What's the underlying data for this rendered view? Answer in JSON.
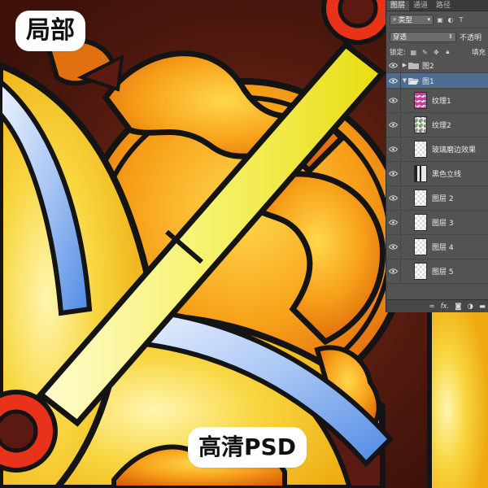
{
  "overlay": {
    "label_local": "局部",
    "label_hd": "高清PSD"
  },
  "layers_panel": {
    "tabs": [
      {
        "label": "图层",
        "active": true
      },
      {
        "label": "通道",
        "active": false
      },
      {
        "label": "路径",
        "active": false
      }
    ],
    "filter": {
      "value": "类型",
      "icons": [
        "image-filter-icon",
        "adjustment-filter-icon",
        "type-filter-icon"
      ]
    },
    "blend_mode": "穿透",
    "opacity_label": "不透明",
    "lock_label": "锁定:",
    "fill_label": "填充",
    "layers": [
      {
        "name": "图2",
        "kind": "group",
        "expanded": false,
        "selected": false,
        "visible": true
      },
      {
        "name": "图1",
        "kind": "group",
        "expanded": true,
        "selected": true,
        "visible": true
      },
      {
        "name": "纹理1",
        "kind": "layer",
        "thumb": "tex1",
        "visible": true
      },
      {
        "name": "纹理2",
        "kind": "layer",
        "thumb": "tex2",
        "visible": true
      },
      {
        "name": "玻璃磨边效果",
        "kind": "layer",
        "thumb": "plain",
        "visible": true
      },
      {
        "name": "黑色立线",
        "kind": "layer",
        "thumb": "dark",
        "visible": true
      },
      {
        "name": "图层 2",
        "kind": "layer",
        "thumb": "plain",
        "visible": true
      },
      {
        "name": "图层 3",
        "kind": "layer",
        "thumb": "plain",
        "visible": true
      },
      {
        "name": "图层 4",
        "kind": "layer",
        "thumb": "plain",
        "visible": true
      },
      {
        "name": "图层 5",
        "kind": "layer",
        "thumb": "plain",
        "visible": true
      }
    ],
    "bottom_icons": [
      "link-icon",
      "fx-icon",
      "mask-icon",
      "adjustment-icon",
      "new-group-icon"
    ],
    "fx_label": "fx."
  },
  "colors": {
    "panel_bg": "#535353",
    "selection": "#4f6d94",
    "glass_red": "#5a1a12",
    "glass_yellow": "#f5c21e",
    "glass_orange": "#f08a12",
    "glass_blue": "#8fb4ea",
    "lead_line": "#141414"
  }
}
